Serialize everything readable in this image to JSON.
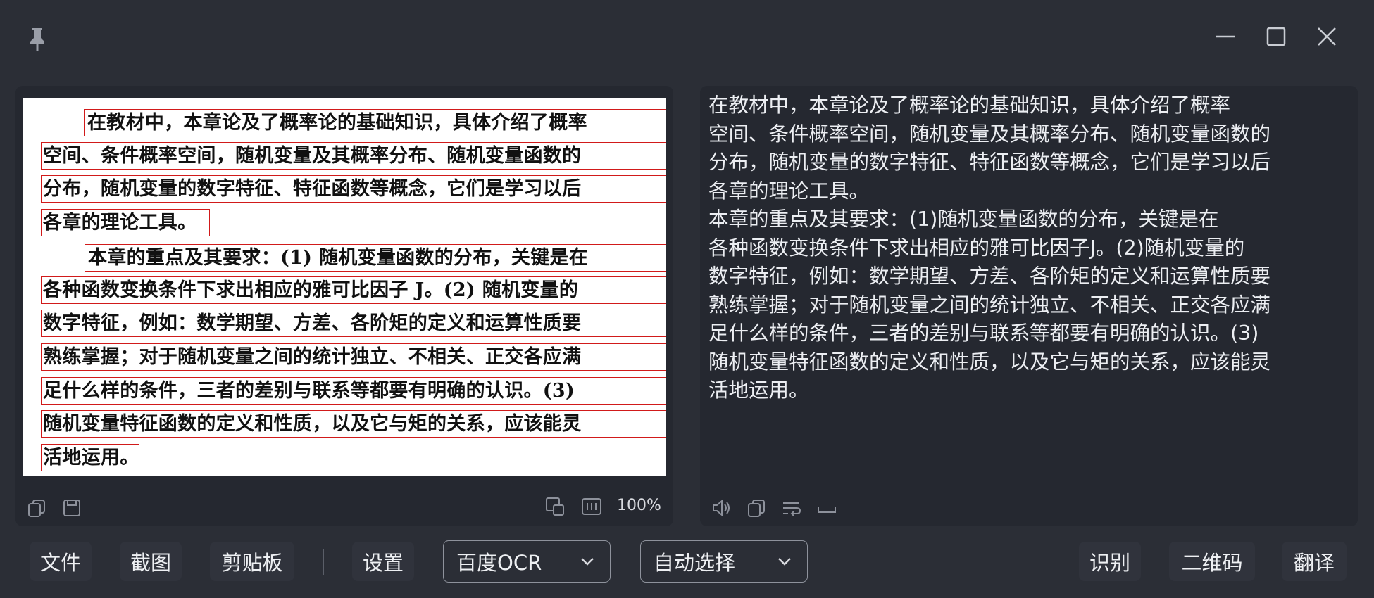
{
  "titlebar": {
    "icons": [
      "pin-icon",
      "minimize-icon",
      "maximize-icon",
      "close-icon"
    ]
  },
  "source_image": {
    "lines": [
      "在教材中，本章论及了概率论的基础知识，具体介绍了概率",
      "空间、条件概率空间，随机变量及其概率分布、随机变量函数的",
      "分布，随机变量的数字特征、特征函数等概念，它们是学习以后",
      "各章的理论工具。",
      "本章的重点及其要求：(1) 随机变量函数的分布，关键是在",
      "各种函数变换条件下求出相应的雅可比因子 J。(2) 随机变量的",
      "数字特征，例如：数学期望、方差、各阶矩的定义和运算性质要",
      "熟练掌握；对于随机变量之间的统计独立、不相关、正交各应满",
      "足什么样的条件，三者的差别与联系等都要有明确的认识。(3)",
      "随机变量特征函数的定义和性质，以及它与矩的关系，应该能灵",
      "活地运用。"
    ],
    "zoom": "100%"
  },
  "left_toolbar": {
    "icons": [
      "copy-icon",
      "save-icon",
      "multi-copy-icon",
      "ocr-mode-icon"
    ]
  },
  "ocr_result": {
    "text": "在教材中，本章论及了概率论的基础知识，具体介绍了概率\n空间、条件概率空间，随机变量及其概率分布、随机变量函数的\n分布，随机变量的数字特征、特征函数等概念，它们是学习以后\n各章的理论工具。\n本章的重点及其要求：(1)随机变量函数的分布，关键是在\n各种函数变换条件下求出相应的雅可比因子J。(2)随机变量的\n数字特征，例如：数学期望、方差、各阶矩的定义和运算性质要\n熟练掌握；对于随机变量之间的统计独立、不相关、正交各应满\n足什么样的条件，三者的差别与联系等都要有明确的认识。(3)\n随机变量特征函数的定义和性质，以及它与矩的关系，应该能灵\n活地运用。"
  },
  "right_toolbar": {
    "icons": [
      "speaker-icon",
      "copy-icon",
      "wrap-icon",
      "space-icon"
    ]
  },
  "bottom_bar": {
    "file": "文件",
    "screenshot": "截图",
    "clipboard": "剪贴板",
    "settings": "设置",
    "ocr_engine": "百度OCR",
    "language": "自动选择",
    "recognize": "识别",
    "qrcode": "二维码",
    "translate": "翻译"
  }
}
